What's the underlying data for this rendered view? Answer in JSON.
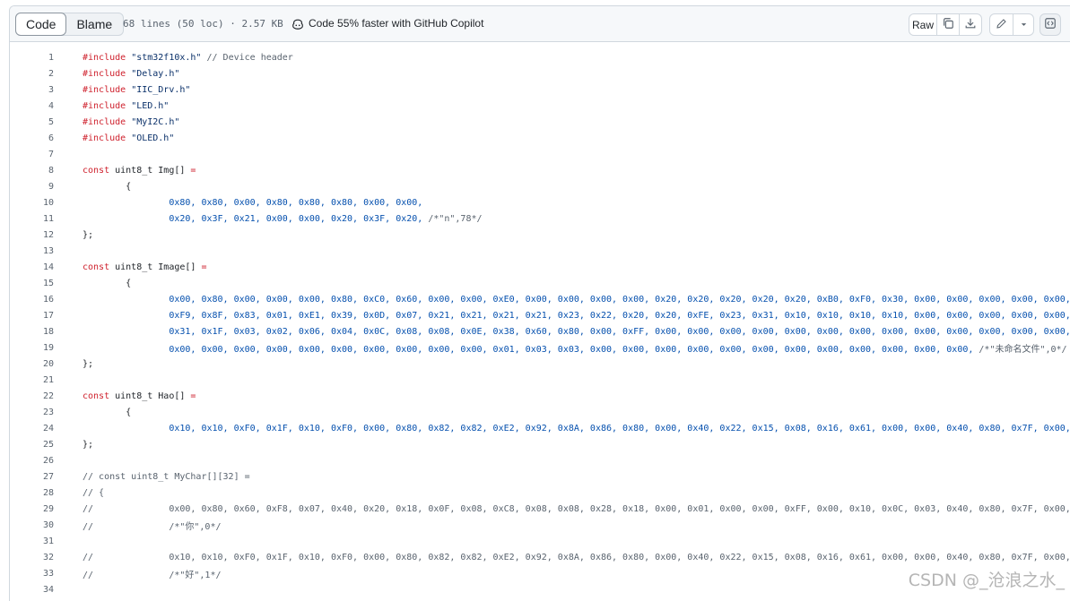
{
  "toolbar": {
    "code_tab": "Code",
    "blame_tab": "Blame",
    "file_info": "68 lines (50 loc) · 2.57 KB",
    "copilot_text": "Code 55% faster with GitHub Copilot",
    "raw_label": "Raw"
  },
  "lines": [
    {
      "n": "1",
      "t": [
        [
          "kw",
          "#include "
        ],
        [
          "str",
          "\"stm32f10x.h\""
        ],
        [
          "com",
          " // Device header"
        ]
      ]
    },
    {
      "n": "2",
      "t": [
        [
          "kw",
          "#include "
        ],
        [
          "str",
          "\"Delay.h\""
        ]
      ]
    },
    {
      "n": "3",
      "t": [
        [
          "kw",
          "#include "
        ],
        [
          "str",
          "\"IIC_Drv.h\""
        ]
      ]
    },
    {
      "n": "4",
      "t": [
        [
          "kw",
          "#include "
        ],
        [
          "str",
          "\"LED.h\""
        ]
      ]
    },
    {
      "n": "5",
      "t": [
        [
          "kw",
          "#include "
        ],
        [
          "str",
          "\"MyI2C.h\""
        ]
      ]
    },
    {
      "n": "6",
      "t": [
        [
          "kw",
          "#include "
        ],
        [
          "str",
          "\"OLED.h\""
        ]
      ]
    },
    {
      "n": "7",
      "t": []
    },
    {
      "n": "8",
      "t": [
        [
          "kw",
          "const "
        ],
        [
          "",
          "uint8_t Img[] "
        ],
        [
          "kw",
          "="
        ]
      ]
    },
    {
      "n": "9",
      "t": [
        [
          "",
          "        {"
        ]
      ]
    },
    {
      "n": "10",
      "t": [
        [
          "num",
          "                0x80, 0x80, 0x00, 0x80, 0x80, 0x80, 0x00, 0x00,"
        ]
      ]
    },
    {
      "n": "11",
      "t": [
        [
          "num",
          "                0x20, 0x3F, 0x21, 0x00, 0x00, 0x20, 0x3F, 0x20, "
        ],
        [
          "com",
          "/*\"n\",78*/"
        ]
      ]
    },
    {
      "n": "12",
      "t": [
        [
          "",
          "};"
        ]
      ]
    },
    {
      "n": "13",
      "t": []
    },
    {
      "n": "14",
      "t": [
        [
          "kw",
          "const "
        ],
        [
          "",
          "uint8_t Image[] "
        ],
        [
          "kw",
          "="
        ]
      ]
    },
    {
      "n": "15",
      "t": [
        [
          "",
          "        {"
        ]
      ]
    },
    {
      "n": "16",
      "t": [
        [
          "num",
          "                0x00, 0x80, 0x00, 0x00, 0x00, 0x80, 0xC0, 0x60, 0x00, 0x00, 0xE0, 0x00, 0x00, 0x00, 0x00, 0x20, 0x20, 0x20, 0x20, 0x20, 0xB0, 0xF0, 0x30, 0x00, 0x00, 0x00, 0x00, 0x00, 0x"
        ]
      ]
    },
    {
      "n": "17",
      "t": [
        [
          "num",
          "                0xF9, 0x8F, 0x83, 0x01, 0xE1, 0x39, 0x0D, 0x07, 0x21, 0x21, 0x21, 0x21, 0x23, 0x22, 0x20, 0x20, 0xFE, 0x23, 0x31, 0x10, 0x10, 0x10, 0x10, 0x00, 0x00, 0x00, 0x00, 0x00, 0x"
        ]
      ]
    },
    {
      "n": "18",
      "t": [
        [
          "num",
          "                0x31, 0x1F, 0x03, 0x02, 0x06, 0x04, 0x0C, 0x08, 0x08, 0x0E, 0x38, 0x60, 0x80, 0x00, 0xFF, 0x00, 0x00, 0x00, 0x00, 0x00, 0x00, 0x00, 0x00, 0x00, 0x00, 0x00, 0x00, 0x00, 0x"
        ]
      ]
    },
    {
      "n": "19",
      "t": [
        [
          "num",
          "                0x00, 0x00, 0x00, 0x00, 0x00, 0x00, 0x00, 0x00, 0x00, 0x00, 0x01, 0x03, 0x03, 0x00, 0x00, 0x00, 0x00, 0x00, 0x00, 0x00, 0x00, 0x00, 0x00, 0x00, 0x00, "
        ],
        [
          "com",
          "/*\"未命名文件\",0*/"
        ]
      ]
    },
    {
      "n": "20",
      "t": [
        [
          "",
          "};"
        ]
      ]
    },
    {
      "n": "21",
      "t": []
    },
    {
      "n": "22",
      "t": [
        [
          "kw",
          "const "
        ],
        [
          "",
          "uint8_t Hao[] "
        ],
        [
          "kw",
          "="
        ]
      ]
    },
    {
      "n": "23",
      "t": [
        [
          "",
          "        {"
        ]
      ]
    },
    {
      "n": "24",
      "t": [
        [
          "num",
          "                0x10, 0x10, 0xF0, 0x1F, 0x10, 0xF0, 0x00, 0x80, 0x82, 0x82, 0xE2, 0x92, 0x8A, 0x86, 0x80, 0x00, 0x40, 0x22, 0x15, 0x08, 0x16, 0x61, 0x00, 0x00, 0x40, 0x80, 0x7F, 0x00, 0x"
        ]
      ]
    },
    {
      "n": "25",
      "t": [
        [
          "",
          "};"
        ]
      ]
    },
    {
      "n": "26",
      "t": []
    },
    {
      "n": "27",
      "t": [
        [
          "com",
          "// const uint8_t MyChar[][32] ="
        ]
      ]
    },
    {
      "n": "28",
      "t": [
        [
          "com",
          "// {"
        ]
      ]
    },
    {
      "n": "29",
      "t": [
        [
          "com",
          "//              0x00, 0x80, 0x60, 0xF8, 0x07, 0x40, 0x20, 0x18, 0x0F, 0x08, 0xC8, 0x08, 0x08, 0x28, 0x18, 0x00, 0x01, 0x00, 0x00, 0xFF, 0x00, 0x10, 0x0C, 0x03, 0x40, 0x80, 0x7F, 0x00, 0x"
        ]
      ]
    },
    {
      "n": "30",
      "t": [
        [
          "com",
          "//              /*\"你\",0*/"
        ]
      ]
    },
    {
      "n": "31",
      "t": []
    },
    {
      "n": "32",
      "t": [
        [
          "com",
          "//              0x10, 0x10, 0xF0, 0x1F, 0x10, 0xF0, 0x00, 0x80, 0x82, 0x82, 0xE2, 0x92, 0x8A, 0x86, 0x80, 0x00, 0x40, 0x22, 0x15, 0x08, 0x16, 0x61, 0x00, 0x00, 0x40, 0x80, 0x7F, 0x00, 0x"
        ]
      ]
    },
    {
      "n": "33",
      "t": [
        [
          "com",
          "//              /*\"好\",1*/"
        ]
      ]
    },
    {
      "n": "34",
      "t": []
    }
  ],
  "watermark": "CSDN @_沧浪之水_"
}
